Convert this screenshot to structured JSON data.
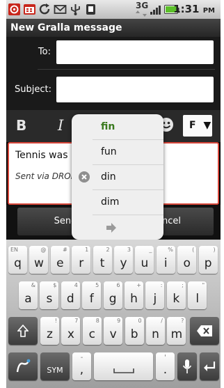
{
  "status_bar": {
    "icons": [
      "gmail-icon",
      "calendar-icon",
      "sync-icon",
      "mail-icon",
      "usb-icon",
      "sd-card-icon",
      "3g-icon",
      "signal-icon",
      "battery-icon"
    ],
    "network": "3G",
    "time": "1:31",
    "ampm": "PM"
  },
  "title": "New Gralla message",
  "compose": {
    "to_label": "To:",
    "to_value": "",
    "subject_label": "Subject:",
    "subject_value": "",
    "body_text": "Tennis was",
    "signature": "Sent via DROI"
  },
  "format_toolbar": {
    "bold": "B",
    "italic": "I",
    "font_label": "F"
  },
  "buttons": {
    "send": "Send",
    "cancel": "Cancel"
  },
  "suggestions": {
    "items": [
      "fin",
      "fun",
      "din",
      "dim"
    ],
    "highlighted_index": 0
  },
  "keyboard": {
    "row1": [
      {
        "key": "q",
        "alt": "EN"
      },
      {
        "key": "w",
        "alt": "@"
      },
      {
        "key": "e",
        "alt": "#"
      },
      {
        "key": "r",
        "alt": "1"
      },
      {
        "key": "t",
        "alt": "2"
      },
      {
        "key": "y",
        "alt": "3"
      },
      {
        "key": "u",
        "alt": "_"
      },
      {
        "key": "i",
        "alt": "%"
      },
      {
        "key": "o",
        "alt": "("
      },
      {
        "key": "p",
        "alt": ")"
      }
    ],
    "row2": [
      {
        "key": "a",
        "alt": "&"
      },
      {
        "key": "s",
        "alt": "$"
      },
      {
        "key": "d",
        "alt": "4"
      },
      {
        "key": "f",
        "alt": "5"
      },
      {
        "key": "g",
        "alt": "6"
      },
      {
        "key": "h",
        "alt": "+"
      },
      {
        "key": "j",
        "alt": ":"
      },
      {
        "key": "k",
        "alt": ";"
      },
      {
        "key": "l",
        "alt": "\""
      }
    ],
    "row3": [
      {
        "key": "z",
        "alt": "!"
      },
      {
        "key": "x",
        "alt": "7"
      },
      {
        "key": "c",
        "alt": "8"
      },
      {
        "key": "v",
        "alt": "9"
      },
      {
        "key": "b",
        "alt": "0"
      },
      {
        "key": "n",
        "alt": "/"
      },
      {
        "key": "m",
        "alt": "?"
      }
    ],
    "sym_label": "SYM",
    "comma": ",",
    "period": "."
  },
  "colors": {
    "accent_suggestion": "#3a7a1e",
    "editor_border": "#d8463a"
  }
}
